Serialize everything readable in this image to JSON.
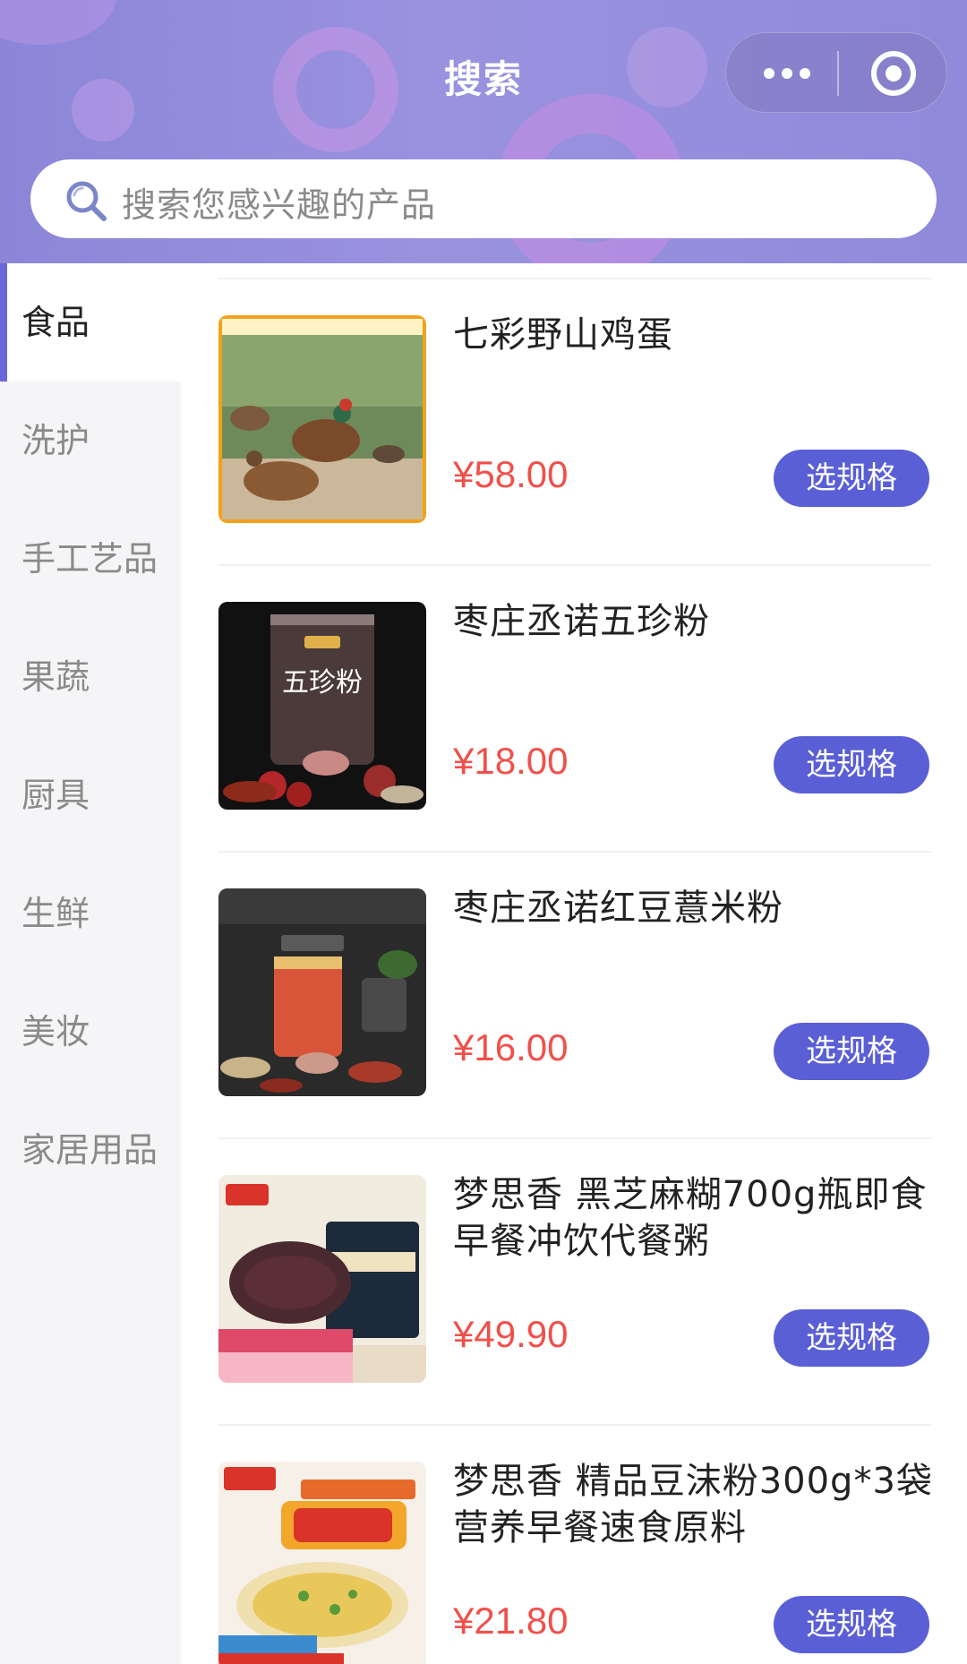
{
  "header": {
    "title": "搜索",
    "accent_color": "#8c86d8",
    "menu_icon": "more-dots-icon",
    "close_icon": "target-circle-icon"
  },
  "search": {
    "placeholder": "搜索您感兴趣的产品",
    "icon": "search-icon"
  },
  "sidebar": {
    "active_color": "#6a68d8",
    "items": [
      {
        "label": "食品",
        "active": true
      },
      {
        "label": "洗护"
      },
      {
        "label": "手工艺品"
      },
      {
        "label": "果蔬"
      },
      {
        "label": "厨具"
      },
      {
        "label": "生鲜"
      },
      {
        "label": "美妆"
      },
      {
        "label": "家居用品"
      }
    ]
  },
  "products": [
    {
      "name": "七彩野山鸡蛋",
      "price": "¥58.00",
      "button": "选规格",
      "image": "pheasant-photo"
    },
    {
      "name": "枣庄丞诺五珍粉",
      "price": "¥18.00",
      "button": "选规格",
      "image": "wuzhenfen-can-photo"
    },
    {
      "name": "枣庄丞诺红豆薏米粉",
      "price": "¥16.00",
      "button": "选规格",
      "image": "red-bean-powder-photo"
    },
    {
      "name": "梦思香 黑芝麻糊700g瓶即食早餐冲饮代餐粥",
      "price": "¥49.90",
      "button": "选规格",
      "image": "black-sesame-paste-photo"
    },
    {
      "name": "梦思香 精品豆沫粉300g*3袋营养早餐速食原料",
      "price": "¥21.80",
      "button": "选规格",
      "image": "doumo-powder-bag-photo"
    }
  ],
  "colors": {
    "price": "#f0504a",
    "button": "#5a5fd6"
  }
}
